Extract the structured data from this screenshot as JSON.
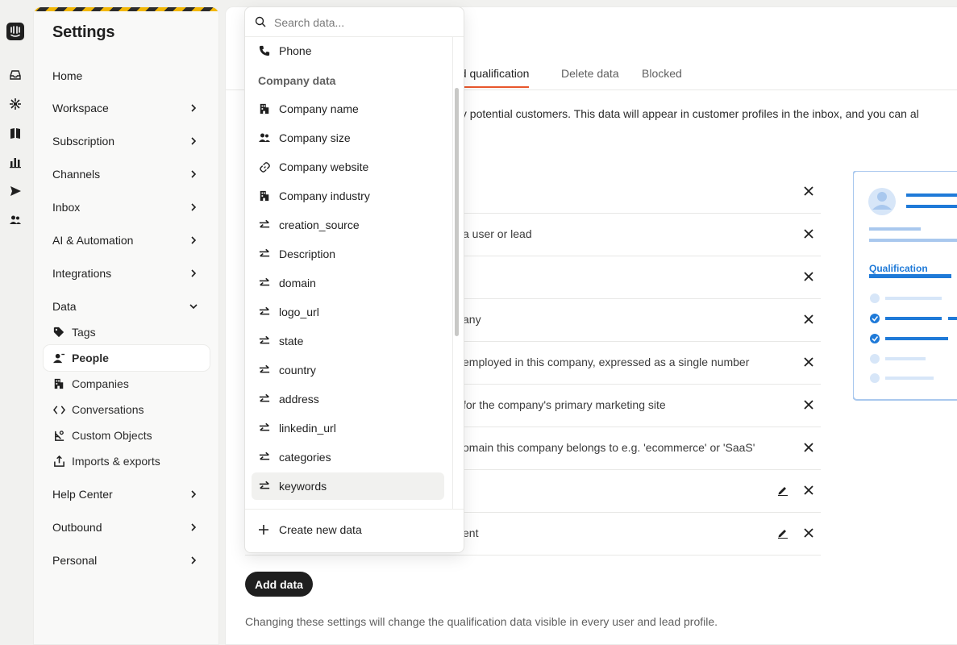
{
  "app": {
    "title": "Settings"
  },
  "nav": {
    "items": [
      {
        "label": "Home",
        "has_chevron": false
      },
      {
        "label": "Workspace",
        "has_chevron": true
      },
      {
        "label": "Subscription",
        "has_chevron": true
      },
      {
        "label": "Channels",
        "has_chevron": true
      },
      {
        "label": "Inbox",
        "has_chevron": true
      },
      {
        "label": "AI & Automation",
        "has_chevron": true
      },
      {
        "label": "Integrations",
        "has_chevron": true
      },
      {
        "label": "Data",
        "expanded": true
      }
    ],
    "data_children": [
      {
        "label": "Tags",
        "icon": "tag-icon"
      },
      {
        "label": "People",
        "icon": "person-icon",
        "active": true
      },
      {
        "label": "Companies",
        "icon": "building-icon"
      },
      {
        "label": "Conversations",
        "icon": "code-icon"
      },
      {
        "label": "Custom Objects",
        "icon": "objects-icon"
      },
      {
        "label": "Imports & exports",
        "icon": "export-icon"
      }
    ],
    "after": [
      {
        "label": "Help Center"
      },
      {
        "label": "Outbound"
      },
      {
        "label": "Personal"
      }
    ]
  },
  "main": {
    "tabs": [
      {
        "label": "nd qualification",
        "active": true
      },
      {
        "label": "Delete data"
      },
      {
        "label": "Blocked"
      }
    ],
    "intro": "fy potential customers. This data will appear in customer profiles in the inbox, and you can al",
    "rows": [
      {
        "text": "",
        "editable": false
      },
      {
        "text": "a user or lead",
        "editable": false
      },
      {
        "text": "",
        "editable": false
      },
      {
        "text": "any",
        "editable": false
      },
      {
        "text": "employed in this company, expressed as a single number",
        "editable": false
      },
      {
        "text": "for the company's primary marketing site",
        "editable": false
      },
      {
        "text": "omain this company belongs to e.g. 'ecommerce' or 'SaaS'",
        "editable": false
      },
      {
        "text": "",
        "editable": true
      },
      {
        "text": "ent",
        "editable": true
      }
    ],
    "add_button": "Add data",
    "footer": "Changing these settings will change the qualification data visible in every user and lead profile.",
    "illustration_label": "Qualification"
  },
  "dropdown": {
    "search_placeholder": "Search data...",
    "top_item": {
      "label": "Phone",
      "icon": "phone-icon"
    },
    "group_label": "Company data",
    "options": [
      {
        "label": "Company name",
        "icon": "building-icon"
      },
      {
        "label": "Company size",
        "icon": "people-icon"
      },
      {
        "label": "Company website",
        "icon": "link-icon"
      },
      {
        "label": "Company industry",
        "icon": "building-icon"
      },
      {
        "label": "creation_source",
        "icon": "arrows-icon"
      },
      {
        "label": "Description",
        "icon": "arrows-icon"
      },
      {
        "label": "domain",
        "icon": "arrows-icon"
      },
      {
        "label": "logo_url",
        "icon": "arrows-icon"
      },
      {
        "label": "state",
        "icon": "arrows-icon"
      },
      {
        "label": "country",
        "icon": "arrows-icon"
      },
      {
        "label": "address",
        "icon": "arrows-icon"
      },
      {
        "label": "linkedin_url",
        "icon": "arrows-icon"
      },
      {
        "label": "categories",
        "icon": "arrows-icon"
      },
      {
        "label": "keywords",
        "icon": "arrows-icon",
        "highlighted": true
      }
    ],
    "create_label": "Create new data"
  },
  "colors": {
    "accent": "#e8572c",
    "brand_blue": "#1f7ad8",
    "dark": "#1f1f1f"
  }
}
